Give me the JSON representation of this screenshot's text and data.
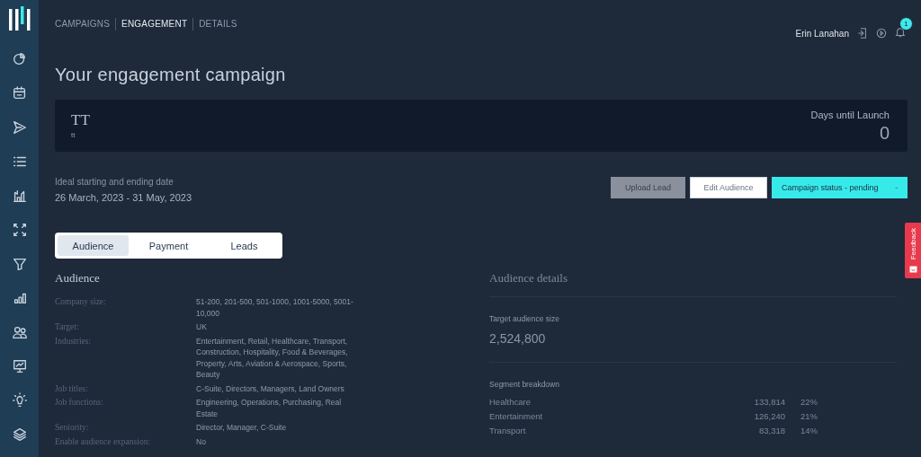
{
  "breadcrumbs": [
    {
      "label": "CAMPAIGNS",
      "selected": false
    },
    {
      "label": "ENGAGEMENT",
      "selected": true
    },
    {
      "label": "DETAILS",
      "selected": false
    }
  ],
  "user": {
    "name": "Erin Lanahan",
    "notifications": "1"
  },
  "title": "Your engagement campaign",
  "campaign": {
    "name": "TT",
    "subtitle": "tt",
    "countdown_label": "Days until Launch",
    "countdown": "0"
  },
  "dates": {
    "label": "Ideal starting and ending date",
    "value": "26 March, 2023 - 31 May, 2023"
  },
  "buttons": [
    {
      "label": "Upload Lead",
      "kind": "disabled"
    },
    {
      "label": "Edit Audience",
      "kind": "secondary"
    },
    {
      "label": "Campaign status - pending",
      "kind": "dropdown"
    }
  ],
  "tabs": [
    {
      "label": "Audience",
      "selected": true
    },
    {
      "label": "Payment",
      "selected": false
    },
    {
      "label": "Leads",
      "selected": false
    }
  ],
  "audience": {
    "heading": "Audience",
    "rows": [
      {
        "label": "Company size:",
        "value": "51-200, 201-500, 501-1000, 1001-5000, 5001-10,000"
      },
      {
        "label": "Target:",
        "value": "UK"
      },
      {
        "label": "Industries:",
        "value": "Entertainment, Retail, Healthcare, Transport, Construction, Hospitality, Food & Beverages, Property, Arts, Aviation & Aerospace, Sports, Beauty"
      },
      {
        "label": "Job titles:",
        "value": "C-Suite, Directors, Managers, Land Owners"
      },
      {
        "label": "Job functions:",
        "value": "Engineering, Operations, Purchasing, Real Estate"
      },
      {
        "label": "Seniority:",
        "value": "Director, Manager, C-Suite"
      },
      {
        "label": "Enable audience expansion:",
        "value": "No"
      }
    ]
  },
  "details": {
    "heading": "Audience details",
    "size_label": "Target audience size",
    "size": "2,524,800",
    "breakdown_label": "Segment breakdown",
    "segments": [
      {
        "name": "Healthcare",
        "count": "133,814",
        "share": "22%"
      },
      {
        "name": "Entertainment",
        "count": "126,240",
        "share": "21%"
      },
      {
        "name": "Transport",
        "count": "83,318",
        "share": "14%"
      }
    ]
  },
  "feedback": "Feedback"
}
